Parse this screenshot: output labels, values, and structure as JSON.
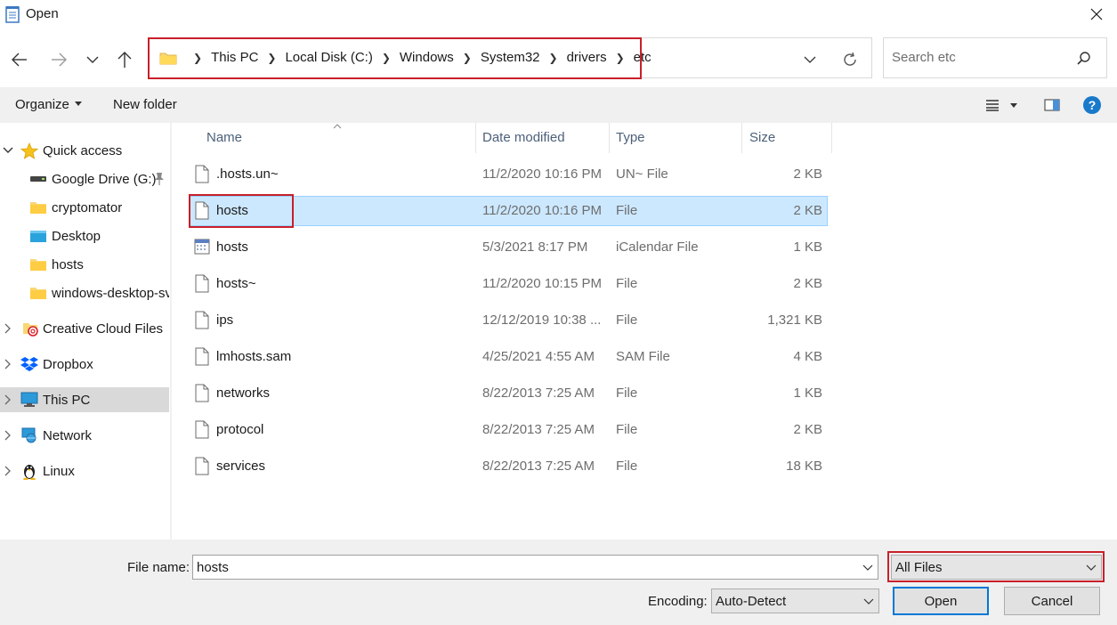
{
  "window": {
    "title": "Open"
  },
  "address": {
    "crumbs": [
      "This PC",
      "Local Disk (C:)",
      "Windows",
      "System32",
      "drivers",
      "etc"
    ]
  },
  "search": {
    "placeholder": "Search etc"
  },
  "toolbar": {
    "organize_label": "Organize",
    "new_folder_label": "New folder"
  },
  "sidebar": {
    "items": [
      {
        "label": "Quick access",
        "icon": "star-icon"
      },
      {
        "label": "Google Drive (G:)",
        "icon": "drive-icon"
      },
      {
        "label": "cryptomator",
        "icon": "folder-icon"
      },
      {
        "label": "Desktop",
        "icon": "desktop-folder-icon"
      },
      {
        "label": "hosts",
        "icon": "folder-icon"
      },
      {
        "label": "windows-desktop-sv",
        "icon": "folder-icon"
      },
      {
        "label": "Creative Cloud Files",
        "icon": "creative-cloud-icon"
      },
      {
        "label": "Dropbox",
        "icon": "dropbox-icon"
      },
      {
        "label": "This PC",
        "icon": "computer-icon"
      },
      {
        "label": "Network",
        "icon": "network-icon"
      },
      {
        "label": "Linux",
        "icon": "linux-penguin-icon"
      }
    ]
  },
  "columns": {
    "name": "Name",
    "date": "Date modified",
    "type": "Type",
    "size": "Size"
  },
  "files": [
    {
      "name": ".hosts.un~",
      "date": "11/2/2020 10:16 PM",
      "type": "UN~ File",
      "size": "2 KB",
      "icon": "file-icon"
    },
    {
      "name": "hosts",
      "date": "11/2/2020 10:16 PM",
      "type": "File",
      "size": "2 KB",
      "icon": "file-icon"
    },
    {
      "name": "hosts",
      "date": "5/3/2021 8:17 PM",
      "type": "iCalendar File",
      "size": "1 KB",
      "icon": "calendar-file-icon"
    },
    {
      "name": "hosts~",
      "date": "11/2/2020 10:15 PM",
      "type": "File",
      "size": "2 KB",
      "icon": "file-icon"
    },
    {
      "name": "ips",
      "date": "12/12/2019 10:38 ...",
      "type": "File",
      "size": "1,321 KB",
      "icon": "file-icon"
    },
    {
      "name": "lmhosts.sam",
      "date": "4/25/2021 4:55 AM",
      "type": "SAM File",
      "size": "4 KB",
      "icon": "file-icon"
    },
    {
      "name": "networks",
      "date": "8/22/2013 7:25 AM",
      "type": "File",
      "size": "1 KB",
      "icon": "file-icon"
    },
    {
      "name": "protocol",
      "date": "8/22/2013 7:25 AM",
      "type": "File",
      "size": "2 KB",
      "icon": "file-icon"
    },
    {
      "name": "services",
      "date": "8/22/2013 7:25 AM",
      "type": "File",
      "size": "18 KB",
      "icon": "file-icon"
    }
  ],
  "footer": {
    "file_name_label": "File name:",
    "file_name_value": "hosts",
    "filter_value": "All Files",
    "encoding_label": "Encoding:",
    "encoding_value": "Auto-Detect",
    "open_label": "Open",
    "cancel_label": "Cancel"
  },
  "colors": {
    "highlight": "#c8202a",
    "selection": "#cce8ff",
    "accent": "#0078d7"
  }
}
